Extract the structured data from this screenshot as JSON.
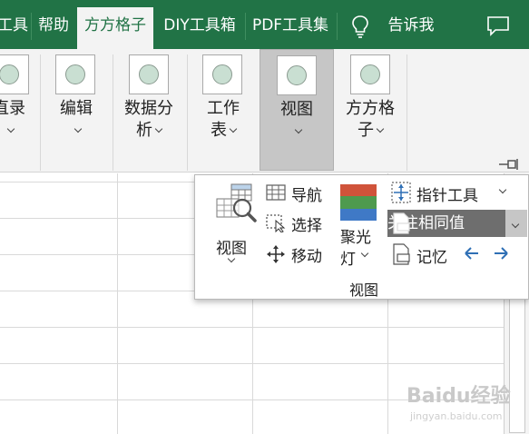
{
  "tabs": [
    {
      "label": "工具",
      "active": false
    },
    {
      "label": "帮助",
      "active": false
    },
    {
      "label": "方方格子",
      "active": true
    },
    {
      "label": "DIY工具箱",
      "active": false
    },
    {
      "label": "PDF工具集",
      "active": false
    }
  ],
  "tell_me": {
    "label": "告诉我",
    "icon": "lightbulb-icon"
  },
  "comment_icon": "comment-icon",
  "ribbon": {
    "buttons": [
      {
        "line1": "直录",
        "line2": "",
        "has_chevron": true,
        "pressed": false
      },
      {
        "line1": "编辑",
        "line2": "",
        "has_chevron": true,
        "pressed": false
      },
      {
        "line1": "数据分",
        "line2": "析",
        "has_chevron": true,
        "pressed": false
      },
      {
        "line1": "工作",
        "line2": "表",
        "has_chevron": true,
        "pressed": false
      },
      {
        "line1": "视图",
        "line2": "",
        "has_chevron": true,
        "pressed": true
      },
      {
        "line1": "方方格",
        "line2": "子",
        "has_chevron": true,
        "pressed": false
      }
    ]
  },
  "panel": {
    "big_view_label": "视图",
    "navigate_label": "导航",
    "select_label": "选择",
    "move_label": "移动",
    "spotlight_line1": "聚光",
    "spotlight_line2": "灯",
    "pointer_tool_label": "指针工具",
    "focus_same_label": "关注相同值",
    "memory_label": "记忆",
    "group_label": "视图"
  },
  "colors": {
    "tab_green": "#217346",
    "spot_red": "#d0533a",
    "spot_green": "#4e9a4e",
    "spot_blue": "#3f79c6",
    "arrow_blue": "#2f6fb5"
  },
  "watermark": {
    "text": "Baidu经验",
    "sub": "jingyan.baidu.com"
  }
}
